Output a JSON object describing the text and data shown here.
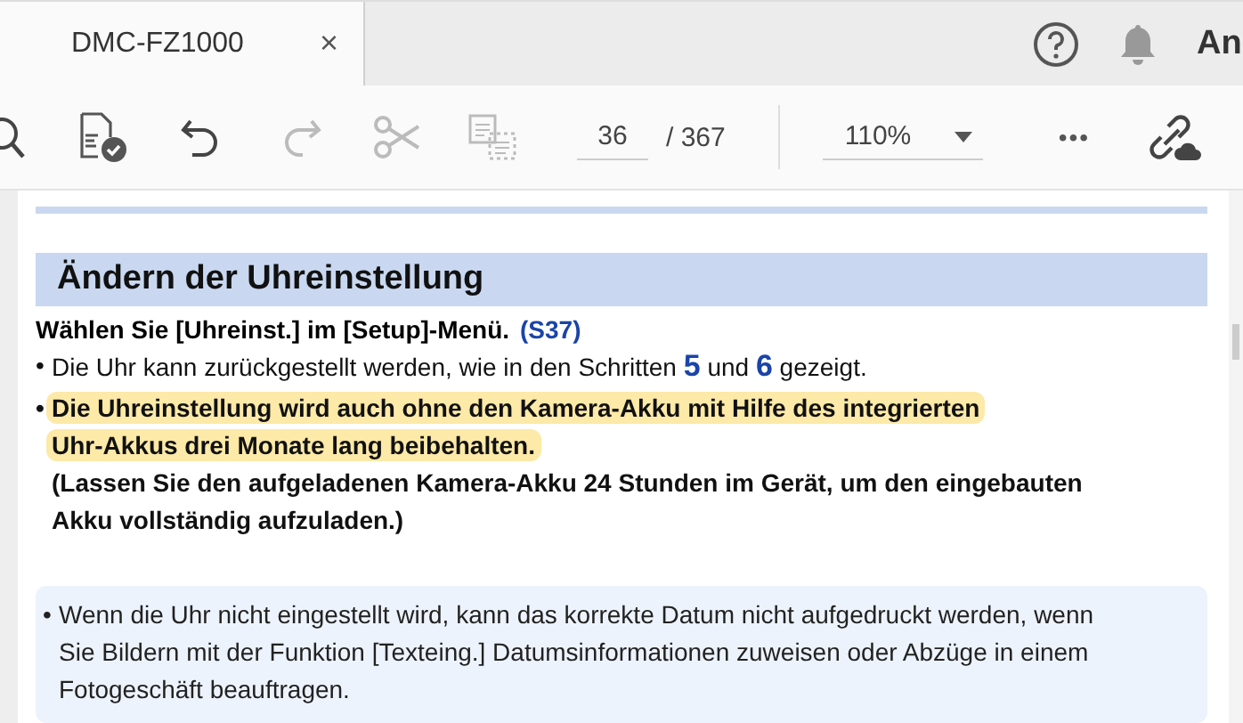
{
  "tab": {
    "title": "DMC-FZ1000",
    "close": "×",
    "selected": true
  },
  "header_user": "An",
  "toolbar": {
    "page": "36",
    "total": "/ 367",
    "zoom": "110%",
    "more": "•••"
  },
  "section": {
    "title": "Ändern der Uhreinstellung",
    "step": "Wählen Sie [Uhreinst.] im [Setup]-Menü.",
    "step_link": "(S37)",
    "bullets": [
      {
        "kind": "plain",
        "bullet": "•",
        "lines": [
          "Die Uhr kann zurückgestellt werden, wie in den Schritten **5** und **6** gezeigt."
        ],
        "highlighted": false
      },
      {
        "kind": "bold",
        "bullet": "•",
        "lines": [
          "Die Uhreinstellung wird auch ohne den Kamera-Akku mit Hilfe des integrierten",
          "Uhr-Akkus drei Monate lang beibehalten."
        ],
        "highlighted": true
      }
    ],
    "note_lines": [
      "(Lassen Sie den aufgeladenen Kamera-Akku 24 Stunden im Gerät, um den eingebauten",
      "Akku vollständig aufzuladen.)"
    ]
  },
  "info_box": {
    "bullet": "•",
    "lines": [
      "Wenn die Uhr nicht eingestellt wird, kann das korrekte Datum nicht aufgedruckt werden, wenn",
      "Sie Bildern mit der Funktion [Texteing.] Datumsinformationen zuweisen oder Abzüge in einem",
      "Fotogeschäft beauftragen."
    ]
  }
}
